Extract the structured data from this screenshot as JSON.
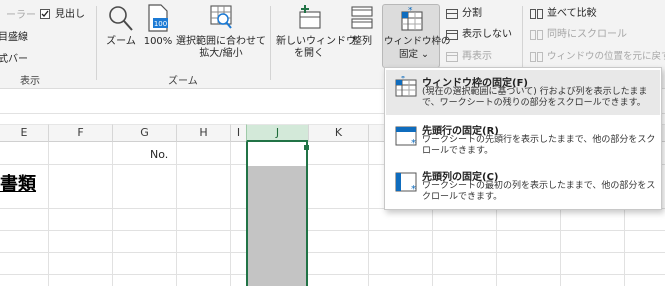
{
  "show_group": {
    "partial_top": "ーラー",
    "gridlines": "目盛線",
    "formula_bar": "式バー",
    "headings": "見出し",
    "label": "表示"
  },
  "zoom_group": {
    "zoom": "ズーム",
    "hundred": "100%",
    "zoom_icon_text": "100",
    "fit_line1": "選択範囲に合わせて",
    "fit_line2": "拡大/縮小",
    "label": "ズーム"
  },
  "window_group": {
    "new_window_line1": "新しいウィンドウ",
    "new_window_line2": "を開く",
    "arrange": "整列",
    "freeze_line1": "ウィンドウ枠の",
    "freeze_line2": "固定 ⌄",
    "split": "分割",
    "hide": "表示しない",
    "unhide": "再表示",
    "side_by_side": "並べて比較",
    "sync_scroll": "同時にスクロール",
    "reset_position": "ウィンドウの位置を元に戻す"
  },
  "columns": [
    "E",
    "F",
    "G",
    "H",
    "I",
    "J",
    "K"
  ],
  "cells": {
    "no_label": "No.",
    "heading_partial": "書類"
  },
  "freeze_menu": {
    "items": [
      {
        "title": "ウィンドウ枠の固定(F)",
        "desc": "(現在の選択範囲に基づいて) 行および列を表示したままで、ワークシートの残りの部分をスクロールできます。"
      },
      {
        "title": "先頭行の固定(R)",
        "desc": "ワークシートの先頭行を表示したままで、他の部分をスクロールできます。"
      },
      {
        "title": "先頭列の固定(C)",
        "desc": "ワークシートの最初の列を表示したままで、他の部分をスクロールできます。"
      }
    ]
  },
  "colors": {
    "accent": "#217346",
    "ribbon_bg": "#f3f3f3",
    "freeze_icon_blue": "#0f6cbd",
    "selected_fill": "#c4c4c4",
    "selected_header": "#d3e9d9"
  }
}
